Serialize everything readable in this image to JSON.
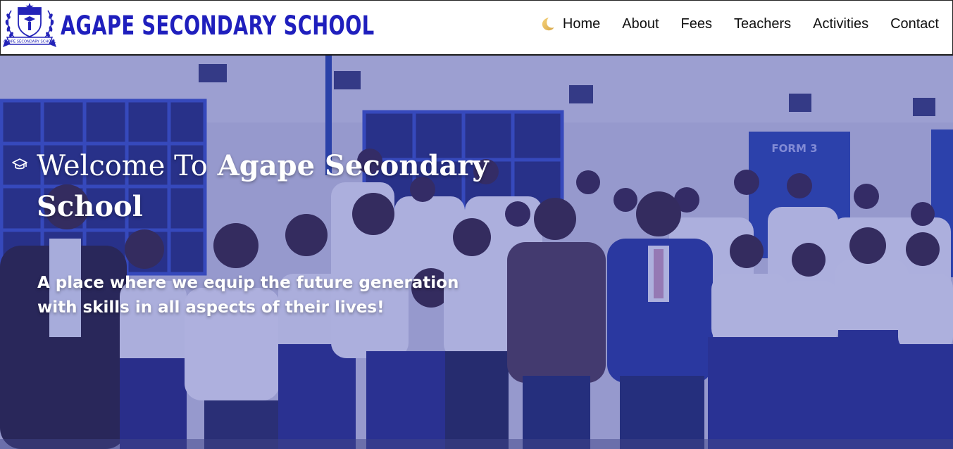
{
  "header": {
    "logo_text": "AGAPE SECONDARY SCHOOL",
    "brand": "AGAPE SECONDARY SCHOOL",
    "theme_icon": "moon-icon",
    "nav": [
      "Home",
      "About",
      "Fees",
      "Teachers",
      "Activities",
      "Contact"
    ]
  },
  "hero": {
    "welcome_lead": "Welcome To",
    "welcome_school": "Agape Secondary School",
    "cap_icon": "graduation-cap-icon",
    "tagline": "A place where we equip the future generation with skills in all aspects of their lives!"
  },
  "colors": {
    "brand_blue": "#1f1fbd",
    "overlay_blue": "#2d33aa",
    "nav_text": "#111111"
  }
}
